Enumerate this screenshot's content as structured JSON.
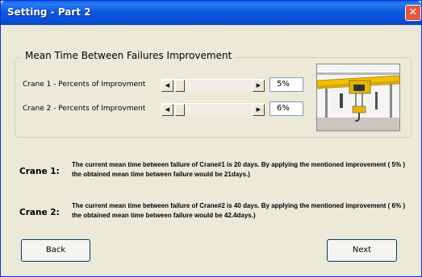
{
  "window": {
    "title": "Setting - Part 2",
    "close_glyph": "✕"
  },
  "group": {
    "title": "Mean Time Between Failures Improvement"
  },
  "cranes": [
    {
      "label": "Crane 1 - Percents of Improvment",
      "value": "5%"
    },
    {
      "label": "Crane 2 - Percents of Improvment",
      "value": "6%"
    }
  ],
  "scrollbar": {
    "left_arrow": "◀",
    "right_arrow": "▶"
  },
  "results": [
    {
      "title": "Crane 1:",
      "text": "The current mean time between failure of Crane#1 is  20  days. By applying the mentioned improvement ( 5% ) the obtained mean time between failure would be  21days.)"
    },
    {
      "title": "Crane 2:",
      "text": "The current mean time between failure of Crane#2 is  40  days. By applying the mentioned improvement ( 6% ) the obtained mean time between failure would be 42.4days.)"
    }
  ],
  "buttons": {
    "back": "Back",
    "next": "Next"
  },
  "image": {
    "icon": "overhead-crane-photo"
  },
  "colors": {
    "title_bar": "#0a58e0",
    "window_bg": "#ece9d8",
    "close": "#e2583c"
  }
}
